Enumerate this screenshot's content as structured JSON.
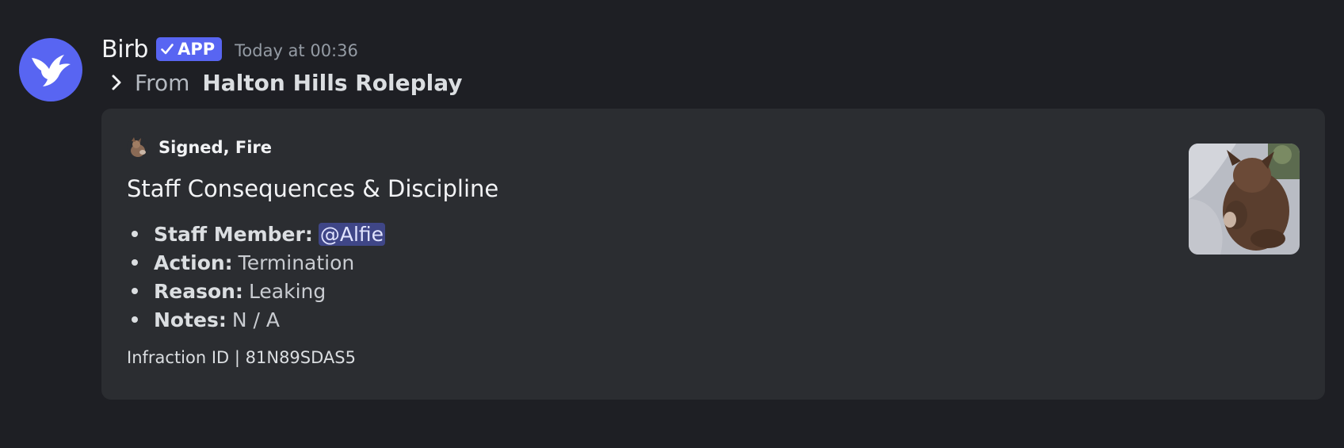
{
  "message": {
    "username": "Birb",
    "badge": "APP",
    "timestamp": "Today at 00:36",
    "forwarded": {
      "from_label": "From",
      "server_name": "Halton Hills Roleplay"
    }
  },
  "embed": {
    "author": "Signed, Fire",
    "title": "Staff Consequences & Discipline",
    "fields": [
      {
        "key": "Staff Member:",
        "value": "@Alfie"
      },
      {
        "key": "Action:",
        "value": "Termination"
      },
      {
        "key": "Reason:",
        "value": "Leaking"
      },
      {
        "key": "Notes:",
        "value": "N / A"
      }
    ],
    "footer": "Infraction ID | 81N89SDAS5"
  },
  "colors": {
    "background": "#1e1f24",
    "embed_background": "#2b2d31",
    "brand": "#5865f2"
  },
  "icons": {
    "avatar": "bird-logo-icon",
    "forward": "chevron-right-icon",
    "badge_check": "check-icon"
  }
}
